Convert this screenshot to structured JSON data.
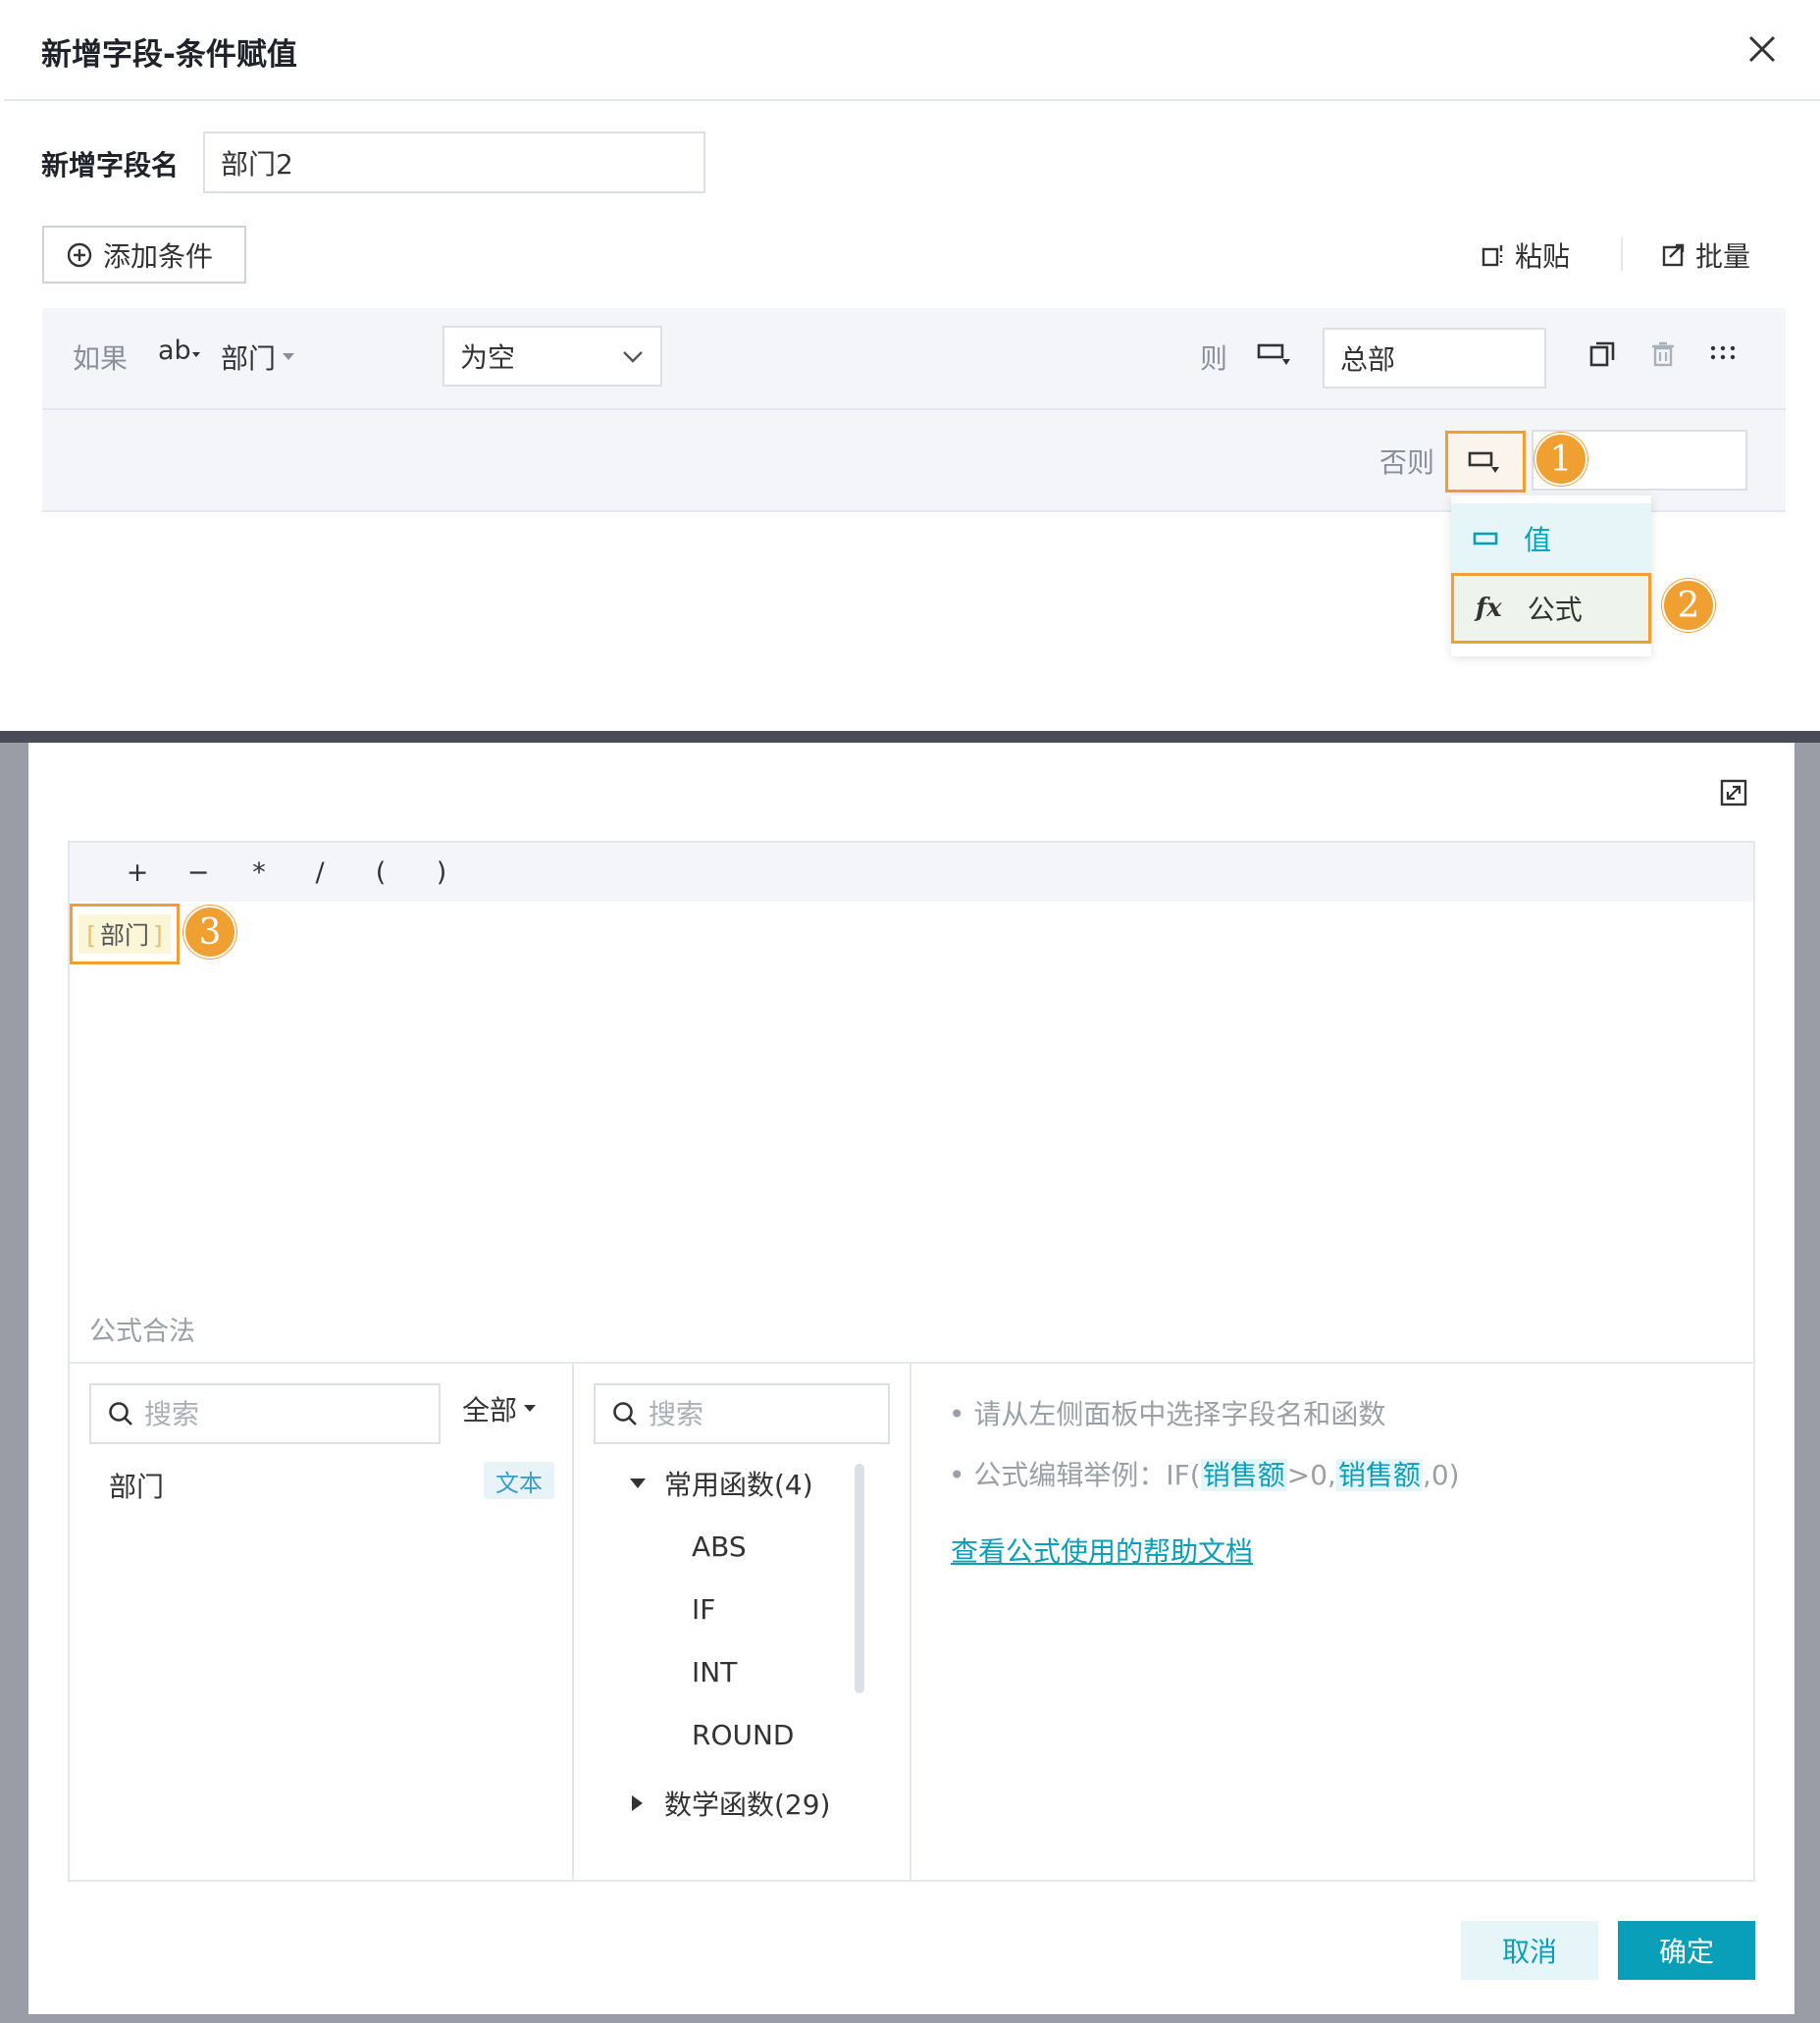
{
  "top_dialog": {
    "title": "新增字段-条件赋值",
    "field_name_label": "新增字段名",
    "field_name_value": "部门2",
    "add_condition_label": "添加条件",
    "paste_label": "粘贴",
    "batch_label": "批量",
    "condition": {
      "if_label": "如果",
      "type_icon_text": "ab",
      "field": "部门",
      "operator": "为空",
      "then_label": "则",
      "then_value": "总部",
      "else_label": "否则"
    },
    "value_type_menu": {
      "items": [
        {
          "label": "值",
          "icon_text": ""
        },
        {
          "label": "公式",
          "icon_text": "fx"
        }
      ]
    },
    "badges": [
      "1",
      "2",
      "3"
    ]
  },
  "formula_dialog": {
    "operators": [
      "+",
      "−",
      "*",
      "/",
      "(",
      ")"
    ],
    "formula_token": {
      "open": "[",
      "text": "部门",
      "close": "]"
    },
    "validity_text": "公式合法",
    "field_panel": {
      "search_placeholder": "搜索",
      "filter_label": "全部",
      "fields": [
        {
          "name": "部门",
          "type": "文本"
        }
      ]
    },
    "function_panel": {
      "search_placeholder": "搜索",
      "groups": [
        {
          "label": "常用函数(4)",
          "expanded": true,
          "children": [
            "ABS",
            "IF",
            "INT",
            "ROUND"
          ]
        },
        {
          "label": "数学函数(29)",
          "expanded": false,
          "children": []
        }
      ]
    },
    "help_panel": {
      "hint1": "• 请从左侧面板中选择字段名和函数",
      "hint2_prefix": "• 公式编辑举例：IF(",
      "hint2_field1": "销售额",
      "hint2_mid": ">0,",
      "hint2_field2": "销售额",
      "hint2_suffix": ",0)",
      "help_link": "查看公式使用的帮助文档"
    },
    "cancel_label": "取消",
    "ok_label": "确定"
  },
  "colors": {
    "accent": "#0a9fb8",
    "highlight": "#f0a030"
  }
}
